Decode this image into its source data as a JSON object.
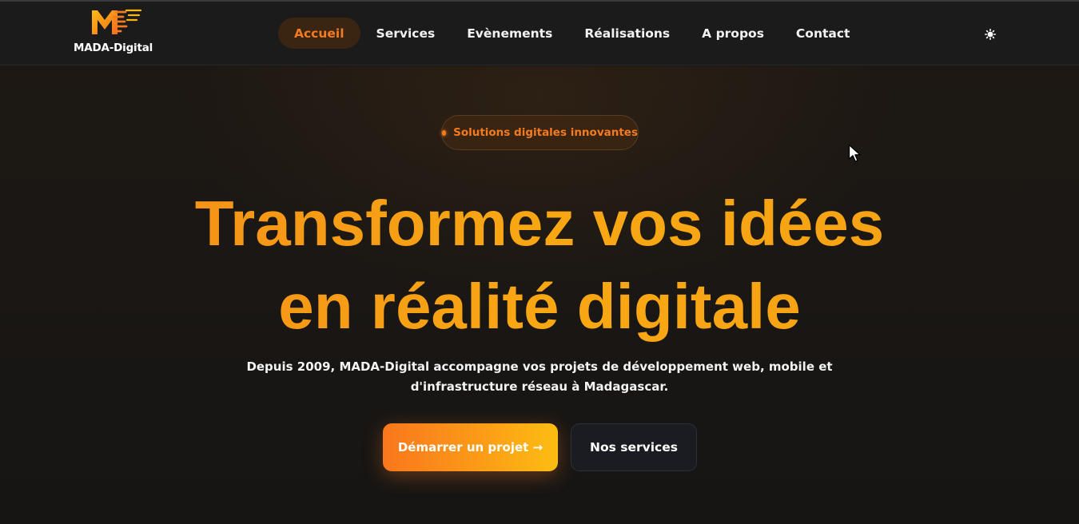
{
  "brand": {
    "name": "MADA-Digital",
    "accent": "#f47b20",
    "gradient_end": "#fdbd12"
  },
  "nav": {
    "items": [
      {
        "label": "Accueil",
        "active": true
      },
      {
        "label": "Services",
        "active": false
      },
      {
        "label": "Evènements",
        "active": false
      },
      {
        "label": "Réalisations",
        "active": false
      },
      {
        "label": "A propos",
        "active": false
      },
      {
        "label": "Contact",
        "active": false
      }
    ],
    "theme_toggle_icon": "sun-icon"
  },
  "hero": {
    "badge": "Solutions digitales innovantes",
    "title_line1": "Transformez vos idées",
    "title_line2": "en réalité digitale",
    "subtitle": "Depuis 2009, MADA-Digital accompagne vos projets de développement web, mobile et d'infrastructure réseau à Madagascar.",
    "primary_button": "Démarrer un projet →",
    "secondary_button": "Nos services"
  }
}
